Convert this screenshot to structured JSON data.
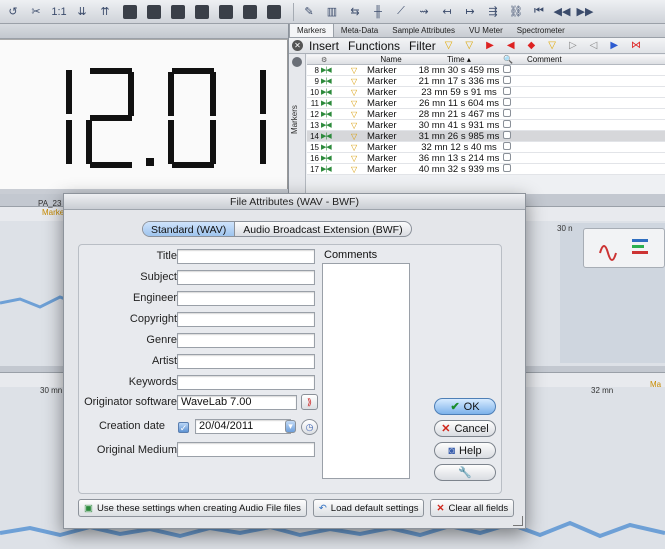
{
  "toolbar": {
    "zoom_label": "1:1"
  },
  "big_display": {
    "digits": [
      "1",
      "2",
      "0",
      "1"
    ]
  },
  "markers_panel": {
    "tabs": [
      "Markers",
      "Meta-Data",
      "Sample Attributes",
      "VU Meter",
      "Spectrometer"
    ],
    "menu": [
      "Insert",
      "Functions",
      "Filter"
    ],
    "side_label": "Markers",
    "columns": [
      "Name",
      "Time",
      "Comment"
    ],
    "rows": [
      {
        "num": "8",
        "name": "Marker",
        "time": "18 mn 30 s 459 ms"
      },
      {
        "num": "9",
        "name": "Marker",
        "time": "21 mn 17 s 336 ms"
      },
      {
        "num": "10",
        "name": "Marker",
        "time": "23 mn 59 s 91 ms"
      },
      {
        "num": "11",
        "name": "Marker",
        "time": "26 mn 11 s 604 ms"
      },
      {
        "num": "12",
        "name": "Marker",
        "time": "28 mn 21 s 467 ms"
      },
      {
        "num": "13",
        "name": "Marker",
        "time": "30 mn 41 s 931 ms"
      },
      {
        "num": "14",
        "name": "Marker",
        "time": "31 mn 26 s 985 ms"
      },
      {
        "num": "15",
        "name": "Marker",
        "time": "32 mn 12 s 40 ms"
      },
      {
        "num": "16",
        "name": "Marker",
        "time": "36 mn 13 s 214 ms"
      },
      {
        "num": "17",
        "name": "Marker",
        "time": "40 mn 32 s 939 ms"
      }
    ]
  },
  "waveform": {
    "track_label": "PA_23",
    "ruler_left": "30 mn 2",
    "ruler_right": "32 mn",
    "ruler_top_right": "30 n",
    "marker_label": "Marke",
    "marker_label_right": "Ma"
  },
  "dialog": {
    "title": "File Attributes (WAV - BWF)",
    "tabs": [
      "Standard (WAV)",
      "Audio Broadcast Extension (BWF)"
    ],
    "fields": [
      {
        "label": "Title",
        "value": ""
      },
      {
        "label": "Subject",
        "value": ""
      },
      {
        "label": "Engineer",
        "value": ""
      },
      {
        "label": "Copyright",
        "value": ""
      },
      {
        "label": "Genre",
        "value": ""
      },
      {
        "label": "Artist",
        "value": ""
      },
      {
        "label": "Keywords",
        "value": ""
      }
    ],
    "originator_label": "Originator software",
    "originator_value": "WaveLab 7.00",
    "creation_label": "Creation date",
    "creation_value": "20/04/2011",
    "medium_label": "Original Medium",
    "medium_value": "",
    "comments_label": "Comments",
    "ok_label": "OK",
    "cancel_label": "Cancel",
    "help_label": "Help",
    "bottom": {
      "use_settings": "Use these settings when creating Audio File files",
      "load_default": "Load default settings",
      "clear_fields": "Clear all fields"
    }
  }
}
